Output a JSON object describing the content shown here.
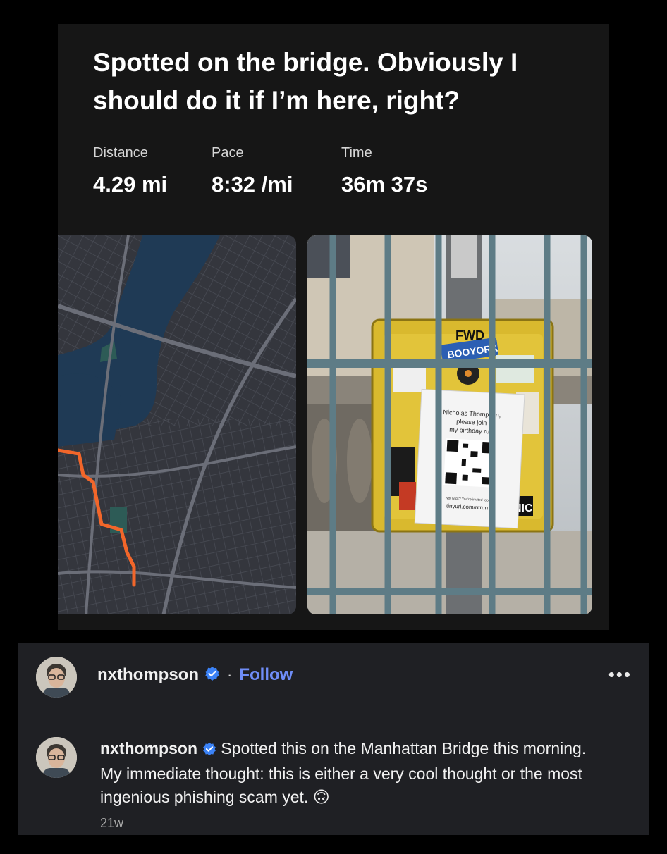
{
  "activity": {
    "title": "Spotted on the bridge. Obviously I should do it if I’m here, right?",
    "stats": [
      {
        "label": "Distance",
        "value": "4.29 mi"
      },
      {
        "label": "Pace",
        "value": "8:32 /mi"
      },
      {
        "label": "Time",
        "value": "36m 37s"
      }
    ]
  },
  "photo": {
    "flyer_line1": "Nicholas Thompson,",
    "flyer_line2": "please join",
    "flyer_line3": "my birthday run",
    "flyer_small": "Not Nick? You're invited too!",
    "flyer_url": "tinyurl.com/ntrun",
    "sticker_booyork": "BOOYORK",
    "sticker_fwd": "FWD",
    "sticker_nic": "NIC"
  },
  "post": {
    "username": "nxthompson",
    "follow_label": "Follow",
    "separator": "·",
    "more_label": "•••",
    "caption_username": "nxthompson",
    "caption_text": " Spotted this on the Manhattan Bridge this morning. My immediate thought: this is either a very cool thought or the most ingenious phishing scam yet. 🙃",
    "time_ago": "21w"
  },
  "colors": {
    "card_bg": "#161616",
    "comment_bg": "#1f2024",
    "route": "#f2662a",
    "follow": "#6f8df7",
    "verified": "#3b82f6"
  }
}
